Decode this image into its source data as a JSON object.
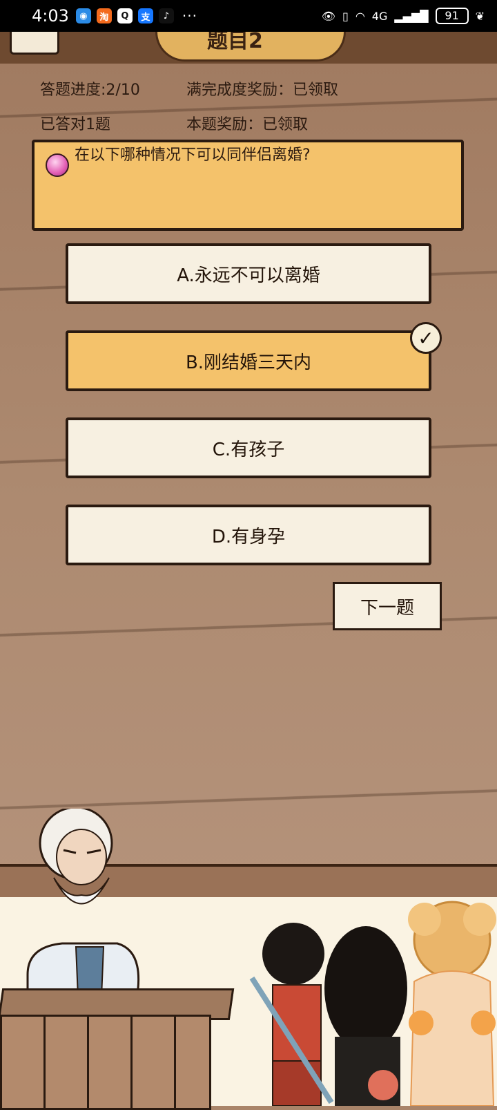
{
  "status_bar": {
    "time": "4:03",
    "apps": [
      {
        "name": "browser-icon",
        "glyph": "◉",
        "color": "#2b8be6"
      },
      {
        "name": "taobao-icon",
        "glyph": "淘",
        "color": "#f36a1d"
      },
      {
        "name": "qq-icon",
        "glyph": "Q",
        "color": "#222222"
      },
      {
        "name": "alipay-icon",
        "glyph": "支",
        "color": "#1677ff"
      },
      {
        "name": "tiktok-icon",
        "glyph": "♪",
        "color": "#111111"
      }
    ],
    "more": "···",
    "network": "4G",
    "battery": "91"
  },
  "header": {
    "title": "题目2"
  },
  "info": {
    "progress": "答题进度:2/10",
    "full_reward": "满完成度奖励：已领取",
    "correct_count": "已答对1题",
    "question_reward": "本题奖励：已领取"
  },
  "question": {
    "text": "在以下哪种情况下可以同伴侣离婚?"
  },
  "options": [
    {
      "label": "A.永远不可以离婚",
      "selected": false
    },
    {
      "label": "B.刚结婚三天内",
      "selected": true
    },
    {
      "label": "C.有孩子",
      "selected": false
    },
    {
      "label": "D.有身孕",
      "selected": false
    }
  ],
  "next_button": "下一题"
}
